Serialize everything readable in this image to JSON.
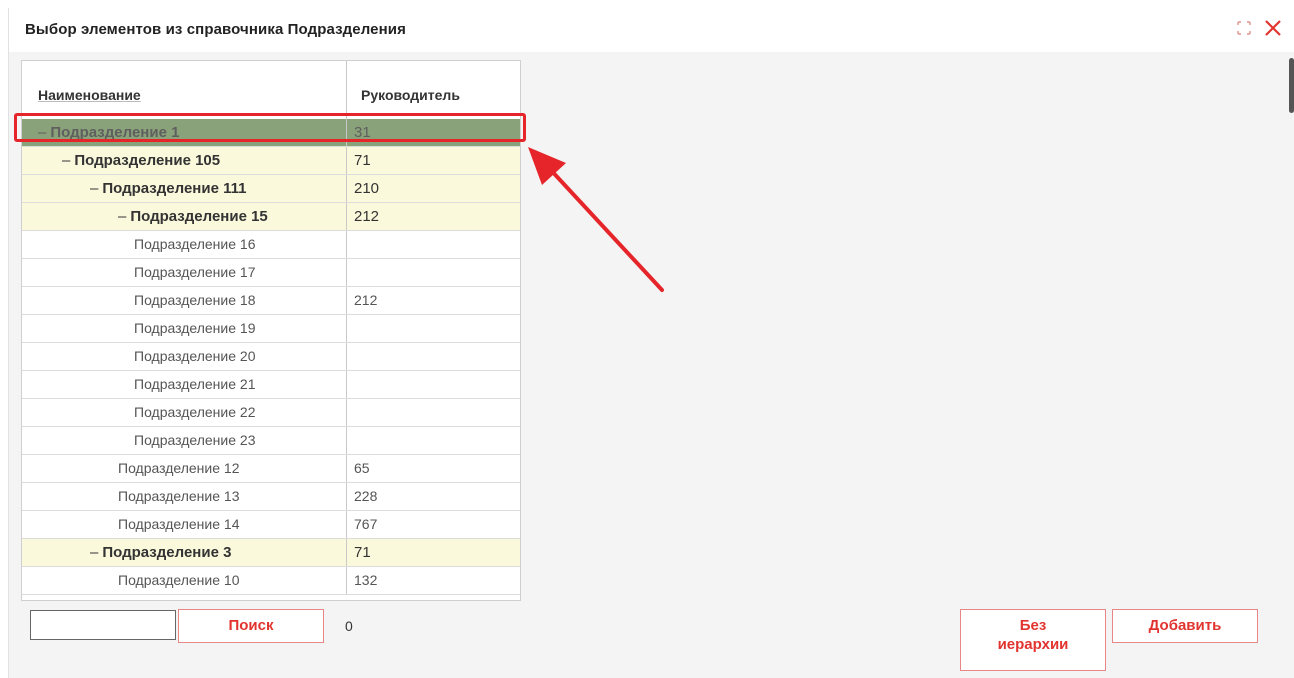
{
  "dialog": {
    "title": "Выбор элементов из справочника Подразделения"
  },
  "grid": {
    "columns": [
      "Наименование",
      "Руководитель"
    ],
    "rows": [
      {
        "name": "Подразделение 1",
        "lead": "31",
        "level": 0,
        "expanded": true,
        "group": true
      },
      {
        "name": "Подразделение 105",
        "lead": "71",
        "level": 1,
        "expanded": true,
        "group": true
      },
      {
        "name": "Подразделение 111",
        "lead": "210",
        "level": 2,
        "expanded": true,
        "group": true
      },
      {
        "name": "Подразделение 15",
        "lead": "212",
        "level": 3,
        "expanded": true,
        "group": true
      },
      {
        "name": "Подразделение 16",
        "lead": "",
        "level": 4,
        "group": false
      },
      {
        "name": "Подразделение 17",
        "lead": "",
        "level": 4,
        "group": false
      },
      {
        "name": "Подразделение 18",
        "lead": "212",
        "level": 4,
        "group": false
      },
      {
        "name": "Подразделение 19",
        "lead": "",
        "level": 4,
        "group": false
      },
      {
        "name": "Подразделение 20",
        "lead": "",
        "level": 4,
        "group": false
      },
      {
        "name": "Подразделение 21",
        "lead": "",
        "level": 4,
        "group": false
      },
      {
        "name": "Подразделение 22",
        "lead": "",
        "level": 4,
        "group": false
      },
      {
        "name": "Подразделение 23",
        "lead": "",
        "level": 4,
        "group": false
      },
      {
        "name": "Подразделение 12",
        "lead": "65",
        "level": 3,
        "group": false
      },
      {
        "name": "Подразделение 13",
        "lead": "228",
        "level": 3,
        "group": false
      },
      {
        "name": "Подразделение 14",
        "lead": "767",
        "level": 3,
        "group": false
      },
      {
        "name": "Подразделение 3",
        "lead": "71",
        "level": 2,
        "expanded": true,
        "group": true
      },
      {
        "name": "Подразделение 10",
        "lead": "132",
        "level": 3,
        "group": false
      }
    ],
    "toggle_symbol": "–"
  },
  "footer": {
    "search_value": "",
    "search_button": "Поиск",
    "result_count": "0",
    "no_hierarchy_line1": "Без",
    "no_hierarchy_line2": "иерархии",
    "add_button": "Добавить"
  },
  "colors": {
    "accent": "#e2342f",
    "group_row": "#fbf9dc",
    "selected_row": "#8aa279",
    "annotation": "#e5252a"
  }
}
